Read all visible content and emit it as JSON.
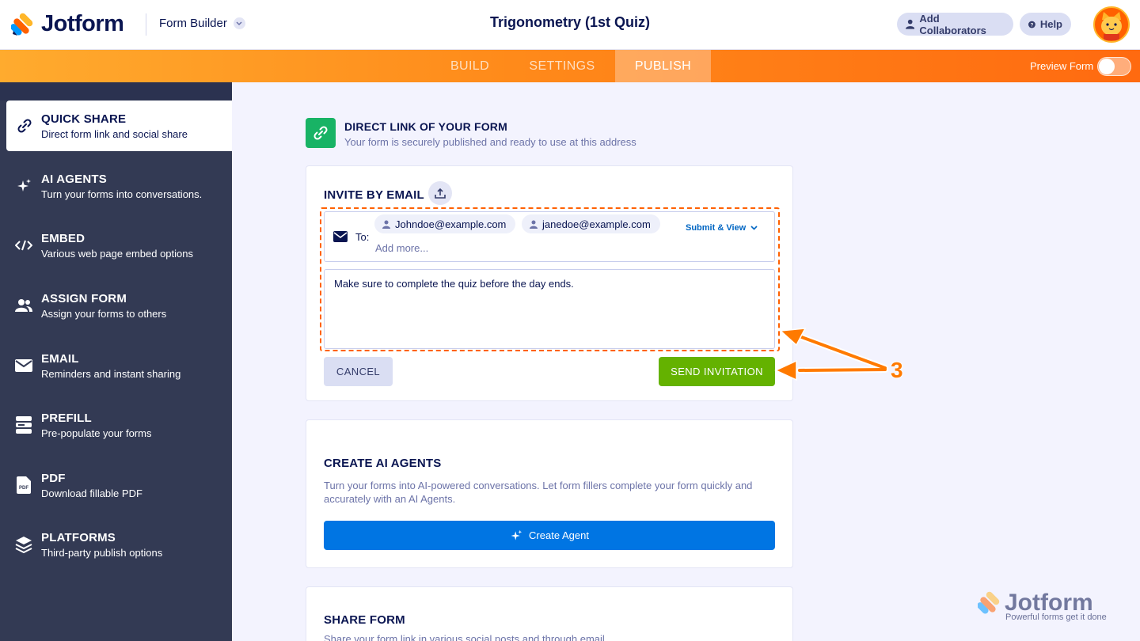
{
  "header": {
    "brand": "Jotform",
    "builder_label": "Form Builder",
    "form_title": "Trigonometry (1st Quiz)",
    "add_collaborators": "Add Collaborators",
    "help": "Help"
  },
  "nav": {
    "tabs": [
      {
        "label": "BUILD",
        "active": false
      },
      {
        "label": "SETTINGS",
        "active": false
      },
      {
        "label": "PUBLISH",
        "active": true
      }
    ],
    "preview_label": "Preview Form",
    "preview_on": false
  },
  "sidebar": {
    "items": [
      {
        "title": "QUICK SHARE",
        "subtitle": "Direct form link and social share",
        "icon": "link-icon",
        "active": true
      },
      {
        "title": "AI AGENTS",
        "subtitle": "Turn your forms into conversations.",
        "icon": "sparkle-icon"
      },
      {
        "title": "EMBED",
        "subtitle": "Various web page embed options",
        "icon": "code-icon"
      },
      {
        "title": "ASSIGN FORM",
        "subtitle": "Assign your forms to others",
        "icon": "users-icon"
      },
      {
        "title": "EMAIL",
        "subtitle": "Reminders and instant sharing",
        "icon": "envelope-icon"
      },
      {
        "title": "PREFILL",
        "subtitle": "Pre-populate your forms",
        "icon": "prefill-icon"
      },
      {
        "title": "PDF",
        "subtitle": "Download fillable PDF",
        "icon": "pdf-icon"
      },
      {
        "title": "PLATFORMS",
        "subtitle": "Third-party publish options",
        "icon": "layers-icon"
      }
    ]
  },
  "direct_link": {
    "title": "DIRECT LINK OF YOUR FORM",
    "subtitle": "Your form is securely published and ready to use at this address"
  },
  "invite": {
    "title": "INVITE BY EMAIL",
    "to_label": "To:",
    "recipients": [
      "Johndoe@example.com",
      "janedoe@example.com"
    ],
    "add_more_placeholder": "Add more...",
    "submit_view": "Submit & View",
    "message": "Make sure to complete the quiz before the day ends.",
    "cancel": "CANCEL",
    "send": "SEND INVITATION"
  },
  "ai_agents": {
    "title": "CREATE AI AGENTS",
    "description": "Turn your forms into AI-powered conversations. Let form fillers complete your form quickly and accurately with an AI Agents.",
    "button": "Create Agent"
  },
  "share_form": {
    "title": "SHARE FORM",
    "description": "Share your form link in various social posts and through email"
  },
  "annotation": {
    "step": "3",
    "color": "#ff7a00"
  },
  "watermark": {
    "brand": "Jotform",
    "tagline": "Powerful forms get it done"
  },
  "colors": {
    "accent_orange": "#ff6100",
    "send_green": "#64b200",
    "agent_blue": "#0075e3",
    "sidebar_bg": "#333a54",
    "link_green": "#18b365"
  }
}
